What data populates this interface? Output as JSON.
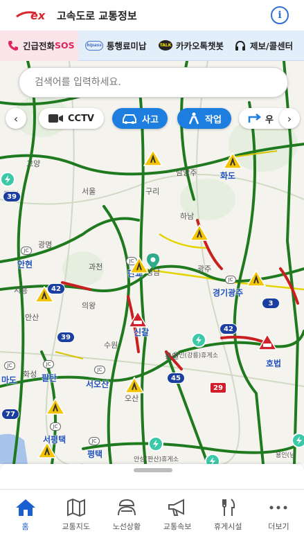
{
  "header": {
    "logo_text": "ex",
    "title": "고속도로 교통정보",
    "info_icon": "info-circle-icon"
  },
  "quickbar": {
    "items": [
      {
        "label": "긴급전화",
        "suffix": "SOS",
        "icon": "phone-icon"
      },
      {
        "label": "통행료미납",
        "icon": "hipass-icon"
      },
      {
        "label": "카카오톡챗봇",
        "icon": "talk-icon"
      },
      {
        "label": "제보/콜센터",
        "icon": "headset-icon"
      }
    ],
    "talk_icon_text": "TALK",
    "hipass_icon_text": "hipass"
  },
  "search": {
    "placeholder": "검색어를 입력하세요."
  },
  "filters": {
    "chips": [
      {
        "label": "CCTV",
        "active": false
      },
      {
        "label": "사고",
        "active": true
      },
      {
        "label": "작업",
        "active": true
      },
      {
        "label": "우",
        "active": false
      }
    ]
  },
  "map": {
    "places": [
      "고양",
      "남양주",
      "서울",
      "구리",
      "하남",
      "광명",
      "과천",
      "성남",
      "광주",
      "시흥",
      "의왕",
      "안산",
      "수원",
      "화성",
      "용인",
      "오산",
      "킨텍스",
      "안성(판산)휴게소",
      "용인(강릉)휴게소",
      "용인(남"
    ],
    "cities": [
      "화도",
      "안현",
      "판교",
      "경기광주",
      "신갈",
      "호법",
      "마도",
      "팔탄",
      "서오산",
      "서평택",
      "평택"
    ],
    "routes": [
      "39",
      "42",
      "3",
      "39",
      "42",
      "45",
      "29",
      "77"
    ],
    "jc_text": "JC"
  },
  "bottomnav": {
    "items": [
      {
        "label": "홈",
        "icon": "home-icon",
        "active": true
      },
      {
        "label": "교통지도",
        "icon": "map-icon",
        "active": false
      },
      {
        "label": "노선상황",
        "icon": "road-status-icon",
        "active": false
      },
      {
        "label": "교통속보",
        "icon": "megaphone-icon",
        "active": false
      },
      {
        "label": "휴게시설",
        "icon": "fork-knife-icon",
        "active": false
      },
      {
        "label": "더보기",
        "icon": "more-dots-icon",
        "active": false
      }
    ]
  },
  "colors": {
    "brand_red": "#d8262f",
    "accent_blue": "#1d7ee0",
    "sos_pink": "#e0245e",
    "road_green": "#1f7a1f",
    "road_red": "#c82020",
    "road_yellow": "#e3d400"
  }
}
